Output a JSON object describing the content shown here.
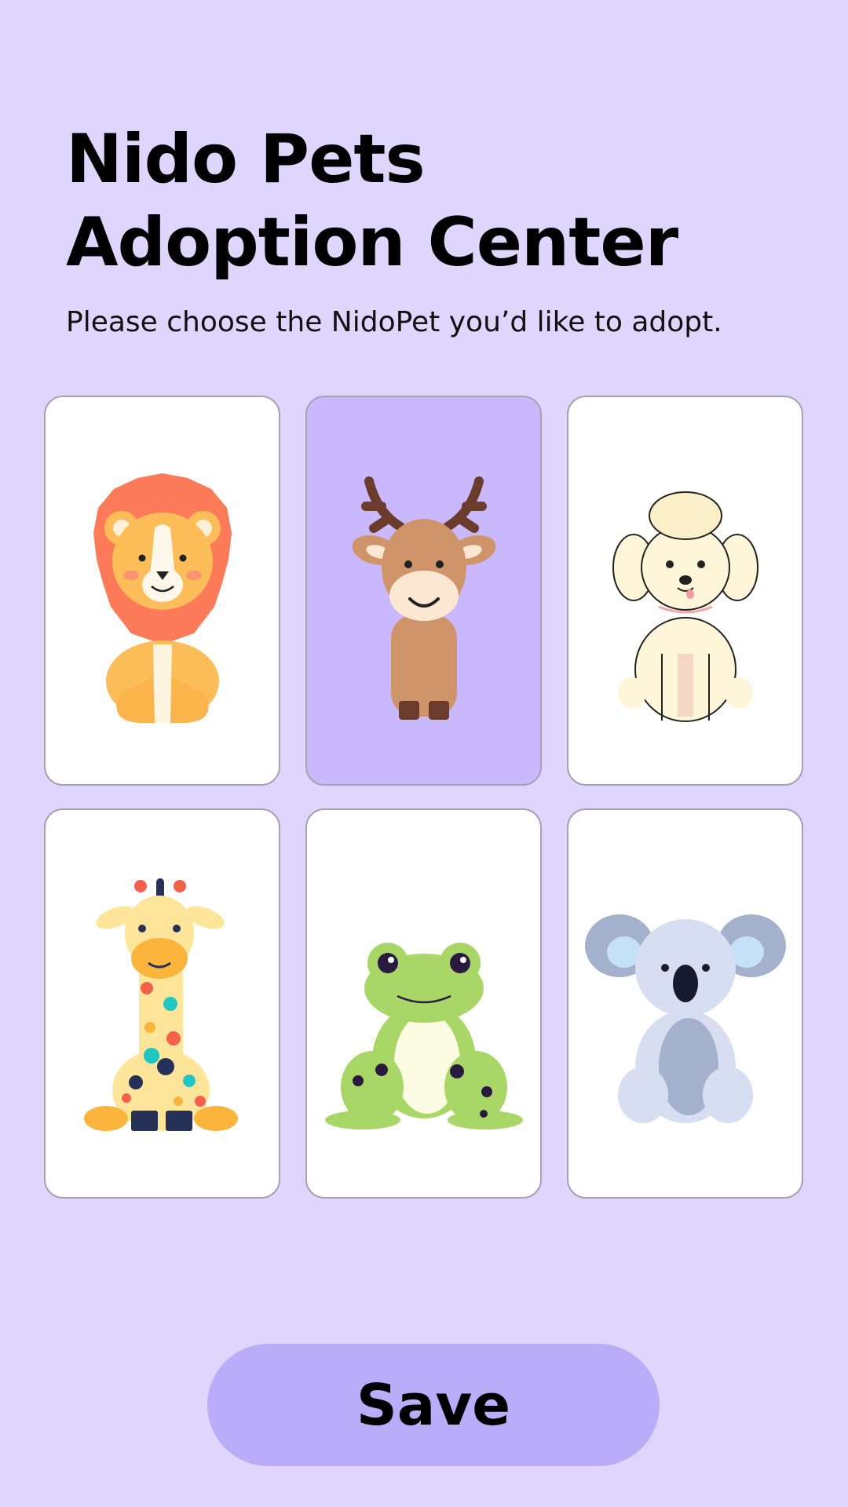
{
  "header": {
    "title_line1": "Nido Pets",
    "title_line2": "Adoption Center",
    "subtitle": "Please choose the NidoPet you’d like to adopt."
  },
  "pets": [
    {
      "name": "lion",
      "icon": "lion-icon",
      "selected": false
    },
    {
      "name": "moose",
      "icon": "moose-icon",
      "selected": true
    },
    {
      "name": "poodle",
      "icon": "poodle-icon",
      "selected": false
    },
    {
      "name": "giraffe",
      "icon": "giraffe-icon",
      "selected": false
    },
    {
      "name": "frog",
      "icon": "frog-icon",
      "selected": false
    },
    {
      "name": "koala",
      "icon": "koala-icon",
      "selected": false
    }
  ],
  "actions": {
    "save_label": "Save"
  },
  "colors": {
    "background": "#dfd6fd",
    "card": "#ffffff",
    "card_selected": "#c9b8fc",
    "save_button": "#b9acf8"
  }
}
